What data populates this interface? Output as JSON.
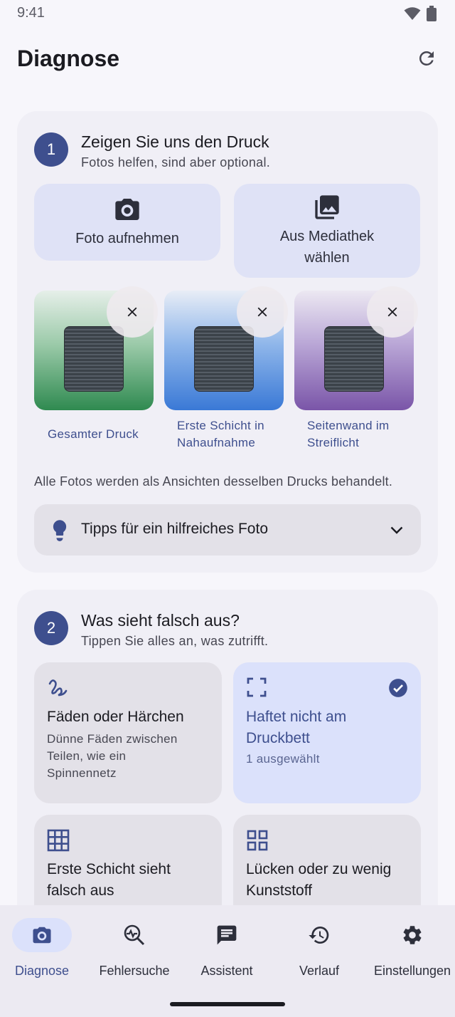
{
  "status_bar": {
    "time": "9:41"
  },
  "header": {
    "title": "Diagnose",
    "refresh_icon": "refresh-icon"
  },
  "step1": {
    "number": "1",
    "title": "Zeigen Sie uns den Druck",
    "subtitle": "Fotos helfen, sind aber optional.",
    "take_photo_label": "Foto aufnehmen",
    "library_label_line1": "Aus Mediathek",
    "library_label_line2": "wählen",
    "photos": [
      {
        "caption_line1": "Gesamter Druck",
        "caption_line2": "",
        "color": "#2f8a50"
      },
      {
        "caption_line1": "Erste Schicht in",
        "caption_line2": "Nahaufnahme",
        "color": "#3a79d6"
      },
      {
        "caption_line1": "Seitenwand im",
        "caption_line2": "Streiflicht",
        "color": "#7a55a8"
      }
    ],
    "note": "Alle Fotos werden als Ansichten desselben Drucks behandelt.",
    "tips_label": "Tipps für ein hilfreiches Foto"
  },
  "step2": {
    "number": "2",
    "title": "Was sieht falsch aus?",
    "subtitle": "Tippen Sie alles an, was zutrifft.",
    "issues": [
      {
        "title_line1": "Fäden oder Härchen",
        "title_line2": "",
        "desc_line1": "Dünne Fäden zwischen",
        "desc_line2": "Teilen, wie ein",
        "desc_line3": "Spinnennetz",
        "selected": false,
        "icon": "stringing-icon"
      },
      {
        "title_line1": "Haftet nicht am",
        "title_line2": "Druckbett",
        "desc_line1": "1 ausgewählt",
        "selected": true,
        "icon": "frame-corners-icon"
      },
      {
        "title_line1": "Erste Schicht sieht",
        "title_line2": "falsch aus",
        "selected": false,
        "icon": "grid-icon"
      },
      {
        "title_line1": "Lücken oder zu wenig",
        "title_line2": "Kunststoff",
        "selected": false,
        "icon": "grid-view-icon"
      }
    ]
  },
  "bottom_nav": {
    "items": [
      {
        "label": "Diagnose",
        "icon": "camera-icon",
        "active": true
      },
      {
        "label": "Fehlersuche",
        "icon": "troubleshoot-icon",
        "active": false
      },
      {
        "label": "Assistent",
        "icon": "chat-icon",
        "active": false
      },
      {
        "label": "Verlauf",
        "icon": "history-icon",
        "active": false
      },
      {
        "label": "Einstellungen",
        "icon": "settings-icon",
        "active": false
      }
    ]
  },
  "colors": {
    "accent": "#3e4f8e",
    "selected_tint": "#dbe1fb",
    "card": "#f0eff6"
  }
}
